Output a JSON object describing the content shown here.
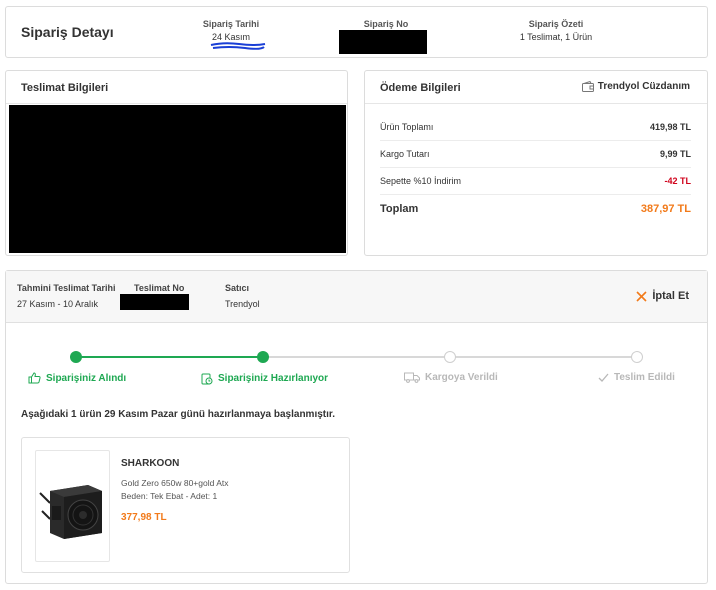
{
  "header": {
    "title": "Sipariş Detayı",
    "order_date_label": "Sipariş Tarihi",
    "order_date_value": "24 Kasım",
    "order_no_label": "Sipariş No",
    "summary_label": "Sipariş Özeti",
    "summary_value": "1 Teslimat, 1 Ürün"
  },
  "delivery": {
    "title": "Teslimat Bilgileri"
  },
  "payment": {
    "title": "Ödeme Bilgileri",
    "wallet_label": "Trendyol Cüzdanım",
    "rows": [
      {
        "label": "Ürün Toplamı",
        "amount": "419,98 TL"
      },
      {
        "label": "Kargo Tutarı",
        "amount": "9,99 TL"
      },
      {
        "label": "Sepette %10 İndirim",
        "amount": "-42 TL"
      }
    ],
    "total_label": "Toplam",
    "total_amount": "387,97 TL"
  },
  "shipment": {
    "est_label": "Tahmini Teslimat Tarihi",
    "est_value": "27 Kasım - 10 Aralık",
    "delivery_no_label": "Teslimat No",
    "seller_label": "Satıcı",
    "seller_value": "Trendyol",
    "cancel_label": "İptal Et",
    "steps": [
      {
        "label": "Siparişiniz Alındı",
        "state": "done",
        "icon": "thumbs-up-icon"
      },
      {
        "label": "Siparişiniz Hazırlanıyor",
        "state": "done",
        "icon": "preparing-clock-icon"
      },
      {
        "label": "Kargoya Verildi",
        "state": "todo",
        "icon": "truck-icon"
      },
      {
        "label": "Teslim Edildi",
        "state": "todo",
        "icon": "check-icon"
      }
    ],
    "message": "Aşağıdaki 1 ürün 29 Kasım Pazar günü hazırlanmaya başlanmıştır."
  },
  "product": {
    "brand": "SHARKOON",
    "name": "Gold Zero 650w 80+gold Atx",
    "attributes": "Beden: Tek Ebat - Adet: 1",
    "price": "377,98 TL"
  },
  "colors": {
    "accent": "#f27a1a",
    "success": "#1ea852",
    "negative": "#d0021b"
  }
}
